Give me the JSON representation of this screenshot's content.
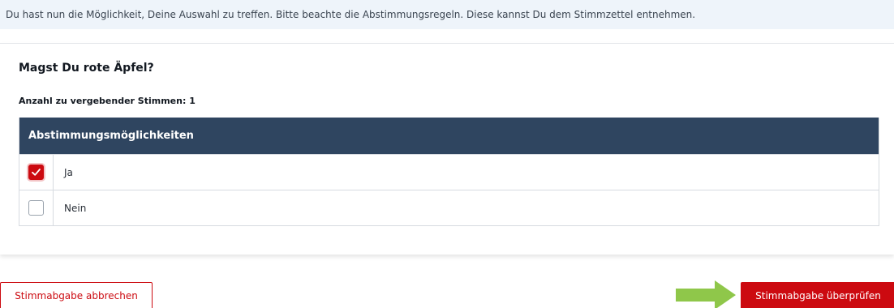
{
  "info": {
    "text": "Du hast nun die Möglichkeit, Deine Auswahl zu treffen. Bitte beachte die Abstimmungsregeln. Diese kannst Du dem Stimmzettel entnehmen."
  },
  "ballot": {
    "question": "Magst Du rote Äpfel?",
    "votes_label": "Anzahl zu vergebender Stimmen: 1",
    "table_header": "Abstimmungsmöglichkeiten",
    "options": [
      {
        "label": "Ja",
        "checked": true
      },
      {
        "label": "Nein",
        "checked": false
      }
    ]
  },
  "actions": {
    "cancel_label": "Stimmabgabe abbrechen",
    "review_label": "Stimmabgabe überprüfen"
  },
  "colors": {
    "accent": "#cc0a10",
    "header": "#2f4560",
    "info_bg": "#eef4fa",
    "arrow": "#8fc74a"
  },
  "icons": {
    "check": "check-icon",
    "arrow": "arrow-right-icon"
  }
}
